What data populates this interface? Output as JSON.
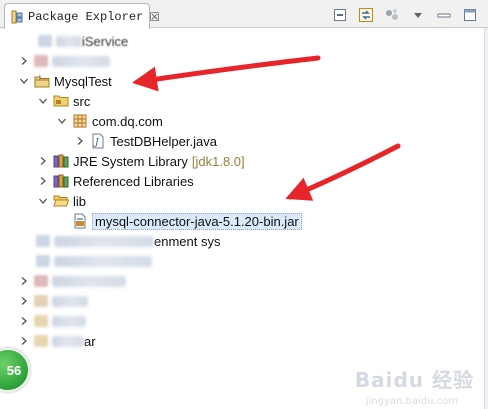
{
  "view": {
    "title": "Package Explorer",
    "close_glyph": "☒",
    "tab_icon": "package-explorer-icon",
    "toolbar": [
      "collapse-all-icon",
      "link-with-editor-icon",
      "filters-icon",
      "view-menu-icon"
    ]
  },
  "tree": {
    "project_top_partial": "iService",
    "project": "MysqlTest",
    "src": "src",
    "package": "com.dq.com",
    "java_file": "TestDBHelper.java",
    "jre_library": "JRE System Library",
    "jre_version": "[jdk1.8.0]",
    "referenced_libraries": "Referenced Libraries",
    "lib_folder": "lib",
    "jar_file": "mysql-connector-java-5.1.20-bin.jar",
    "obscured_project_suffix": "enment sys",
    "obscured_bottom_suffix": "ar"
  },
  "colors": {
    "annotation_arrow": "#e8242b",
    "selection": "#dce9fa",
    "decoration": "#977c3b",
    "badge": "#2fa53a"
  },
  "overlay": {
    "badge_number": "56",
    "watermark": "Baidu 经验",
    "watermark_sub": "jingyan.baidu.com"
  }
}
